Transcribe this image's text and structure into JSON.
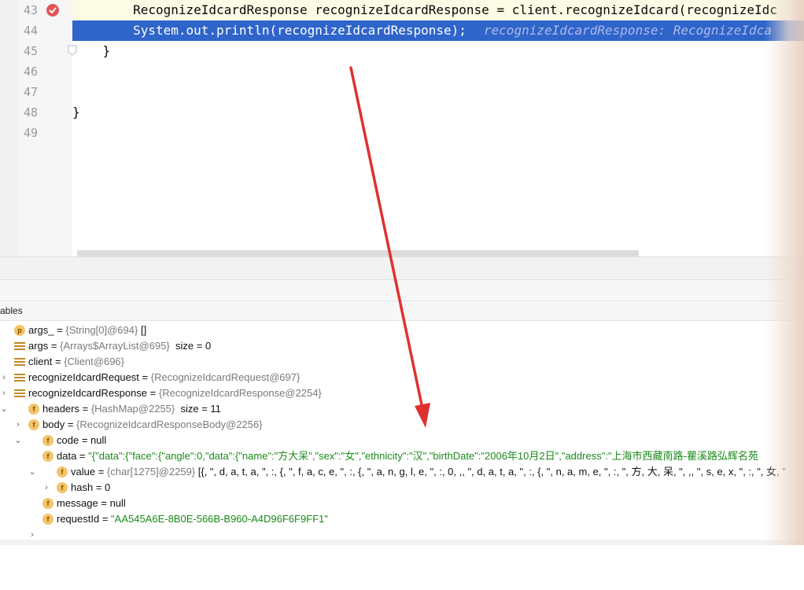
{
  "editor": {
    "lines": [
      {
        "number": "43",
        "code": "        RecognizeIdcardResponse recognizeIdcardResponse = client.recognizeIdcard(recognizeIdc",
        "hint": ""
      },
      {
        "number": "44",
        "code": "        System.out.println(recognizeIdcardResponse);",
        "hint": "recognizeIdcardResponse: RecognizeIdca"
      },
      {
        "number": "45",
        "code": "    }",
        "hint": ""
      },
      {
        "number": "46",
        "code": "",
        "hint": ""
      },
      {
        "number": "47",
        "code": "",
        "hint": ""
      },
      {
        "number": "48",
        "code": "}",
        "hint": ""
      },
      {
        "number": "49",
        "code": "",
        "hint": ""
      }
    ]
  },
  "variables_panel": {
    "title": "ables"
  },
  "tree": [
    {
      "icon": "p",
      "name": "args_",
      "eq": " = ",
      "type": "{String[0]@694}",
      "value": " []",
      "expandable": false
    },
    {
      "icon": "list",
      "name": "args",
      "eq": " = ",
      "type": "{Arrays$ArrayList@695}",
      "value": "  size = 0",
      "expandable": false
    },
    {
      "icon": "list",
      "name": "client",
      "eq": " = ",
      "type": "{Client@696}",
      "value": "",
      "expandable": true
    },
    {
      "icon": "list",
      "name": "recognizeIdcardRequest",
      "eq": " = ",
      "type": "{RecognizeIdcardRequest@697}",
      "value": "",
      "expandable": true
    },
    {
      "icon": "list",
      "name": "recognizeIdcardResponse",
      "eq": " = ",
      "type": "{RecognizeIdcardResponse@2254}",
      "value": "",
      "expandable": true
    },
    {
      "icon": "f",
      "name": "headers",
      "eq": " = ",
      "type": "{HashMap@2255}",
      "value": "  size = 11",
      "expandable": true
    },
    {
      "icon": "f",
      "name": "body",
      "eq": " = ",
      "type": "{RecognizeIdcardResponseBody@2256}",
      "value": "",
      "expandable": true
    },
    {
      "icon": "f",
      "name": "code",
      "eq": " = ",
      "type": "",
      "value": "null",
      "expandable": false
    },
    {
      "icon": "f",
      "name": "data",
      "eq": " = ",
      "type": "",
      "value": "\"{\"data\":{\"face\":{\"angle\":0,\"data\":{\"name\":\"方大呆\",\"sex\":\"女\",\"ethnicity\":\"汉\",\"birthDate\":\"2006年10月2日\",\"address\":\"上海市西藏南路-瞿溪路弘辉名苑",
      "expandable": true
    },
    {
      "icon": "f",
      "name": "value",
      "eq": " = ",
      "type": "{char[1275]@2259}",
      "value": " [{, \", d, a, t, a, \", :, {, \", f, a, c, e, \", :, {, \", a, n, g, l, e, \", :, 0, ,, \", d, a, t, a, \", :, {, \", n, a, m, e, \", :, \", 方, 大, 呆, \", ,, \", s, e, x, \", :, \", 女, \"",
      "expandable": true
    },
    {
      "icon": "f",
      "name": "hash",
      "eq": " = ",
      "type": "",
      "value": "0",
      "expandable": false
    },
    {
      "icon": "f",
      "name": "message",
      "eq": " = ",
      "type": "",
      "value": "null",
      "expandable": false
    },
    {
      "icon": "f",
      "name": "requestId",
      "eq": " = ",
      "type": "",
      "value": "\"AA545A6E-8B0E-566B-B960-A4D96F6F9FF1\"",
      "expandable": true
    }
  ],
  "colors": {
    "selection": "#2f65ca",
    "arrow": "#e03131",
    "string_value": "#1a8a1a"
  },
  "icons": [
    "breakpoint-check-icon",
    "fold-icon",
    "chevron-right-icon",
    "chevron-down-icon",
    "parameter-icon",
    "list-icon",
    "field-icon"
  ]
}
